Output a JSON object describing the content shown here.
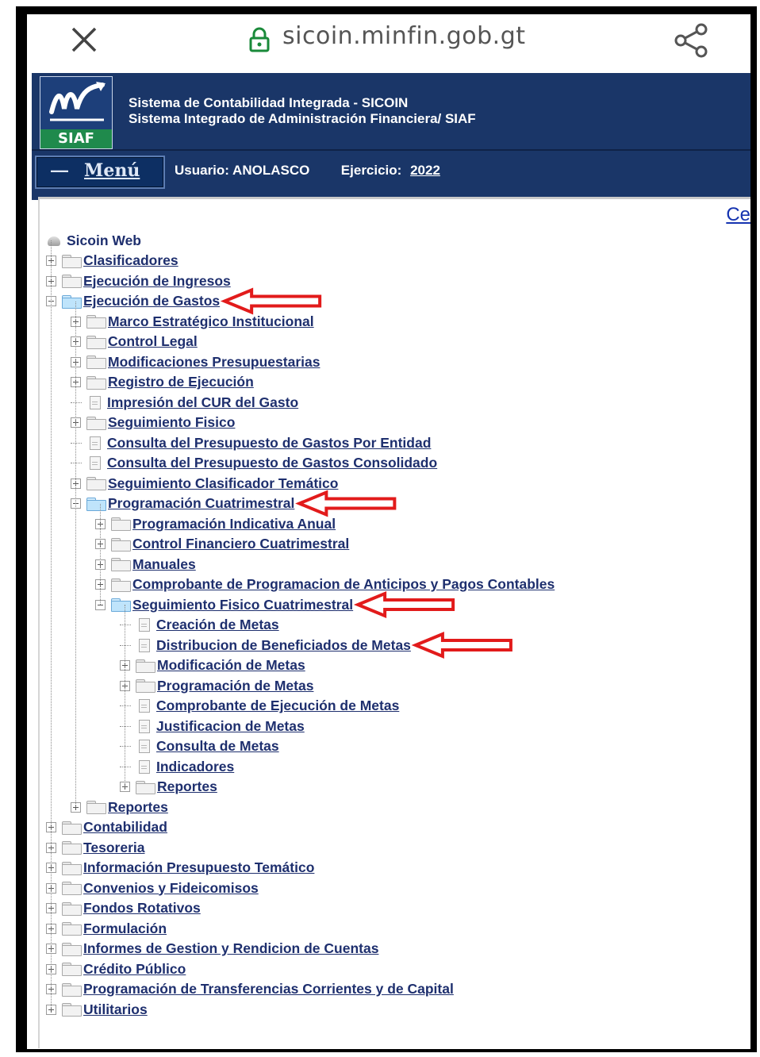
{
  "browser": {
    "url": "sicoin.minfin.gob.gt",
    "close_icon": "close-icon",
    "lock_icon": "lock-icon",
    "share_icon": "share-icon"
  },
  "header": {
    "logo_text": "SIAF",
    "title_line1": "Sistema de Contabilidad Integrada - SICOIN",
    "title_line2": "Sistema Integrado de Administración Financiera/ SIAF",
    "menu_dash": "—",
    "menu_label": "Menú",
    "user_label": "Usuario: ANOLASCO",
    "ejercicio_label": "Ejercicio:",
    "ejercicio_year": "2022",
    "brand_color": "#1a3668"
  },
  "content": {
    "cerrar_label": "Cer"
  },
  "tree": {
    "root": "Sicoin Web",
    "items": [
      {
        "label": "Clasificadores",
        "level": 1,
        "type": "folder",
        "toggle": "plus"
      },
      {
        "label": "Ejecución de Ingresos",
        "level": 1,
        "type": "folder",
        "toggle": "plus"
      },
      {
        "label": "Ejecución de Gastos",
        "level": 1,
        "type": "folder-open",
        "toggle": "minus",
        "highlighted": true
      },
      {
        "label": "Marco Estratégico Institucional",
        "level": 2,
        "type": "folder",
        "toggle": "plus"
      },
      {
        "label": "Control Legal",
        "level": 2,
        "type": "folder",
        "toggle": "plus"
      },
      {
        "label": "Modificaciones Presupuestarias",
        "level": 2,
        "type": "folder",
        "toggle": "plus"
      },
      {
        "label": "Registro de Ejecución",
        "level": 2,
        "type": "folder",
        "toggle": "plus"
      },
      {
        "label": "Impresión del CUR del Gasto",
        "level": 2,
        "type": "page"
      },
      {
        "label": "Seguimiento Fisico",
        "level": 2,
        "type": "folder",
        "toggle": "plus"
      },
      {
        "label": "Consulta del Presupuesto de Gastos Por Entidad",
        "level": 2,
        "type": "page"
      },
      {
        "label": "Consulta del Presupuesto de Gastos Consolidado",
        "level": 2,
        "type": "page"
      },
      {
        "label": "Seguimiento Clasificador Temático",
        "level": 2,
        "type": "folder",
        "toggle": "plus"
      },
      {
        "label": "Programación Cuatrimestral",
        "level": 2,
        "type": "folder-open",
        "toggle": "minus",
        "highlighted": true
      },
      {
        "label": "Programación Indicativa Anual",
        "level": 3,
        "type": "folder",
        "toggle": "plus"
      },
      {
        "label": "Control Financiero Cuatrimestral",
        "level": 3,
        "type": "folder",
        "toggle": "plus"
      },
      {
        "label": "Manuales",
        "level": 3,
        "type": "folder",
        "toggle": "plus"
      },
      {
        "label": "Comprobante de Programacion de Anticipos y Pagos Contables",
        "level": 3,
        "type": "folder",
        "toggle": "plus"
      },
      {
        "label": "Seguimiento Fisico Cuatrimestral",
        "level": 3,
        "type": "folder-open",
        "toggle": "minus",
        "highlighted": true
      },
      {
        "label": "Creación de Metas",
        "level": 4,
        "type": "page"
      },
      {
        "label": "Distribucion de Beneficiados de Metas",
        "level": 4,
        "type": "page",
        "highlighted": true
      },
      {
        "label": "Modificación de Metas",
        "level": 4,
        "type": "folder",
        "toggle": "plus"
      },
      {
        "label": "Programación de Metas",
        "level": 4,
        "type": "folder",
        "toggle": "plus"
      },
      {
        "label": "Comprobante de Ejecución de Metas",
        "level": 4,
        "type": "page"
      },
      {
        "label": "Justificacion de Metas",
        "level": 4,
        "type": "page"
      },
      {
        "label": "Consulta de Metas",
        "level": 4,
        "type": "page"
      },
      {
        "label": "Indicadores",
        "level": 4,
        "type": "page"
      },
      {
        "label": "Reportes",
        "level": 4,
        "type": "folder",
        "toggle": "plus"
      },
      {
        "label": "Reportes",
        "level": 2,
        "type": "folder",
        "toggle": "plus"
      },
      {
        "label": "Contabilidad",
        "level": 1,
        "type": "folder",
        "toggle": "plus"
      },
      {
        "label": "Tesoreria",
        "level": 1,
        "type": "folder",
        "toggle": "plus"
      },
      {
        "label": "Información Presupuesto Temático",
        "level": 1,
        "type": "folder",
        "toggle": "plus"
      },
      {
        "label": "Convenios y Fideicomisos",
        "level": 1,
        "type": "folder",
        "toggle": "plus"
      },
      {
        "label": "Fondos Rotativos",
        "level": 1,
        "type": "folder",
        "toggle": "plus"
      },
      {
        "label": "Formulación",
        "level": 1,
        "type": "folder",
        "toggle": "plus"
      },
      {
        "label": "Informes de Gestion y Rendicion de Cuentas",
        "level": 1,
        "type": "folder",
        "toggle": "plus"
      },
      {
        "label": "Crédito Público",
        "level": 1,
        "type": "folder",
        "toggle": "plus"
      },
      {
        "label": "Programación de Transferencias Corrientes y de Capital",
        "level": 1,
        "type": "folder",
        "toggle": "plus"
      },
      {
        "label": "Utilitarios",
        "level": 1,
        "type": "folder",
        "toggle": "plus"
      }
    ]
  },
  "annotation": {
    "arrow_color": "#e21b1b",
    "arrow_icon": "red-arrow-icon"
  }
}
